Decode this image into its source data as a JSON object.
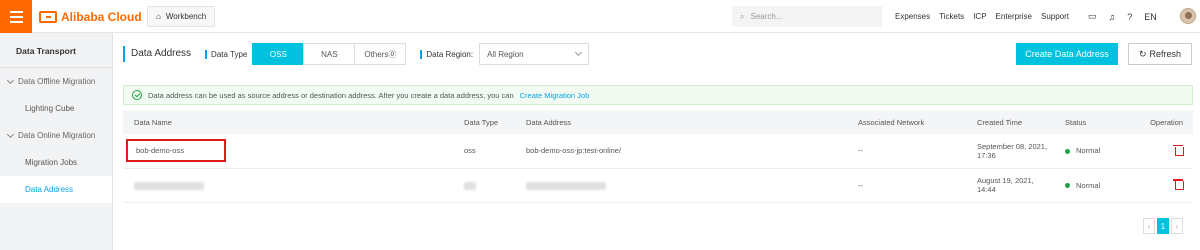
{
  "topbar": {
    "brand": "Alibaba Cloud",
    "workbench": "Workbench",
    "search_placeholder": "Search...",
    "links": [
      "Expenses",
      "Tickets",
      "ICP",
      "Enterprise",
      "Support"
    ],
    "lang": "EN"
  },
  "sidebar": {
    "title": "Data Transport",
    "groups": [
      {
        "label": "Data Offline Migration",
        "items": [
          "Lighting Cube"
        ]
      },
      {
        "label": "Data Online Migration",
        "items": [
          "Migration Jobs",
          "Data Address"
        ]
      }
    ]
  },
  "main": {
    "title": "Data Address",
    "data_type_label": "Data Type",
    "data_types": [
      "OSS",
      "NAS",
      "Others"
    ],
    "selected_type": "OSS",
    "region_label": "Data Region:",
    "region_value": "All Region",
    "create_button": "Create Data Address",
    "refresh_button": "Refresh",
    "notice_text": "Data address can be used as source address or destination address. After you create a data address, you can",
    "notice_link": "Create Migration Job",
    "columns": [
      "Data Name",
      "Data Type",
      "Data Address",
      "Associated Network",
      "Created Time",
      "Status",
      "Operation"
    ],
    "rows": [
      {
        "name": "bob-demo-oss",
        "type": "oss",
        "address": "bob-demo-oss-jp:test-online/",
        "network": "--",
        "created": "September 08, 2021, 17:36",
        "status": "Normal"
      },
      {
        "name": "",
        "type": "",
        "address": "",
        "network": "--",
        "created": "August 19, 2021, 14:44",
        "status": "Normal"
      }
    ],
    "page": "1"
  },
  "colors": {
    "accent": "#00c1de",
    "brand": "#ff6a00",
    "danger": "#e01b1b",
    "success": "#1ea046"
  },
  "icons": [
    "menu-icon",
    "home-icon",
    "search-icon",
    "screen-icon",
    "bell-icon",
    "help-icon",
    "check-circle-icon",
    "refresh-icon",
    "trash-icon",
    "chevron-left-icon",
    "chevron-right-icon"
  ]
}
